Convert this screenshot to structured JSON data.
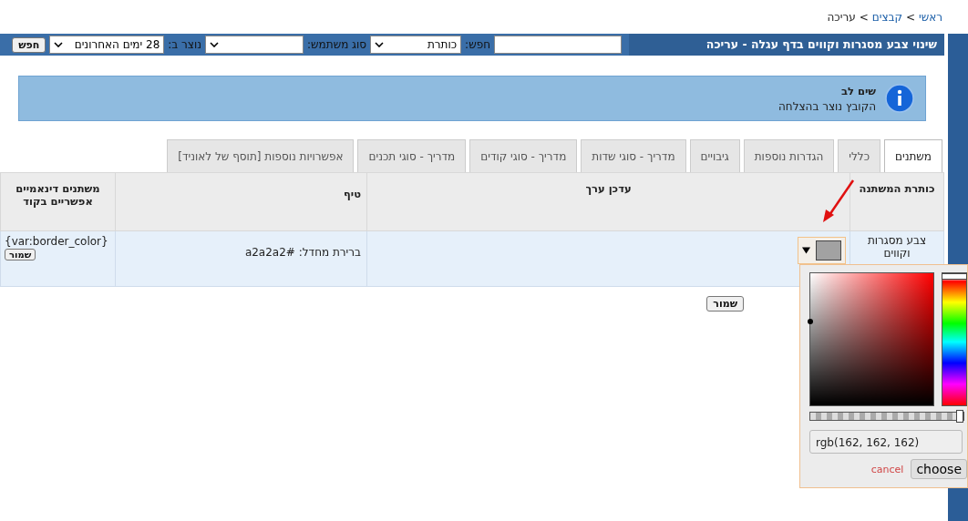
{
  "breadcrumb": [
    {
      "label": "ראשי",
      "kind": "link"
    },
    {
      "label": ">",
      "kind": "sep"
    },
    {
      "label": "קבצים",
      "kind": "link"
    },
    {
      "label": ">",
      "kind": "sep"
    },
    {
      "label": "עריכה",
      "kind": "current"
    }
  ],
  "toolbar": {
    "title": "שינוי צבע מסגרות וקווים בדף עגלה - עריכה",
    "search_label": "חפש:",
    "search_in": "כותרת",
    "user_type_label": "סוג משתמש:",
    "created_label": "נוצר ב:",
    "created_value": "28 ימים האחרונים",
    "button": "חפש"
  },
  "notice": {
    "title": "שים לב",
    "message": "הקובץ נוצר בהצלחה"
  },
  "tabs": [
    {
      "label": "משתנים",
      "selected": true
    },
    {
      "label": "כללי",
      "selected": false
    },
    {
      "label": "הגדרות נוספות",
      "selected": false
    },
    {
      "label": "גיבויים",
      "selected": false
    },
    {
      "label": "מדריך - סוגי שדות",
      "selected": false
    },
    {
      "label": "מדריך - סוגי קודים",
      "selected": false
    },
    {
      "label": "מדריך - סוגי תכנים",
      "selected": false
    },
    {
      "label": "אפשרויות נוספות [תוסף של לאוניד]",
      "selected": false
    }
  ],
  "table": {
    "columns": [
      "כותרת המשתנה",
      "עדכן ערך",
      "טיף",
      "משתנים דינאמיים אפשריים בקוד"
    ],
    "rows": [
      {
        "label": "צבע מסגרות וקווים",
        "color": "#a2a2a2",
        "tip": "ברירת מחדל: #a2a2a2",
        "code": "{var:border_color}",
        "button": "שמור"
      }
    ]
  },
  "save_button": "שמור",
  "color_picker": {
    "hue": {
      "level": 0
    },
    "alpha": {
      "level": 1
    },
    "value": "rgb(162, 162, 162)",
    "cancel": "cancel",
    "choose": "choose"
  }
}
